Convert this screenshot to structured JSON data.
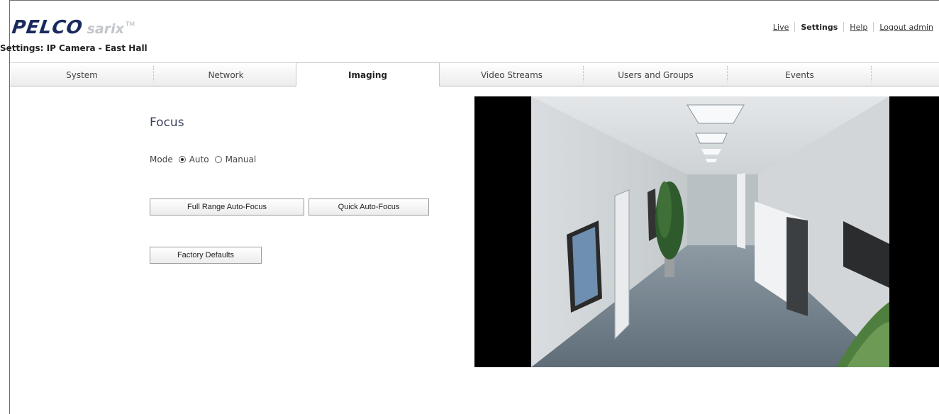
{
  "header": {
    "logo_brand": "PELCO",
    "logo_product": "sarix",
    "logo_tm": "TM",
    "nav": [
      {
        "label": "Live"
      },
      {
        "label": "Settings"
      },
      {
        "label": "Help"
      },
      {
        "label": "Logout admin"
      }
    ]
  },
  "page_title": "Settings: IP Camera - East Hall",
  "tabs": [
    {
      "label": "System"
    },
    {
      "label": "Network"
    },
    {
      "label": "Imaging",
      "active": true
    },
    {
      "label": "Video Streams"
    },
    {
      "label": "Users and Groups"
    },
    {
      "label": "Events"
    }
  ],
  "focus": {
    "heading": "Focus",
    "mode_label": "Mode",
    "mode_options": [
      {
        "label": "Auto",
        "selected": true
      },
      {
        "label": "Manual",
        "selected": false
      }
    ],
    "full_range_button": "Full Range Auto-Focus",
    "quick_button": "Quick Auto-Focus",
    "factory_defaults_button": "Factory Defaults"
  }
}
